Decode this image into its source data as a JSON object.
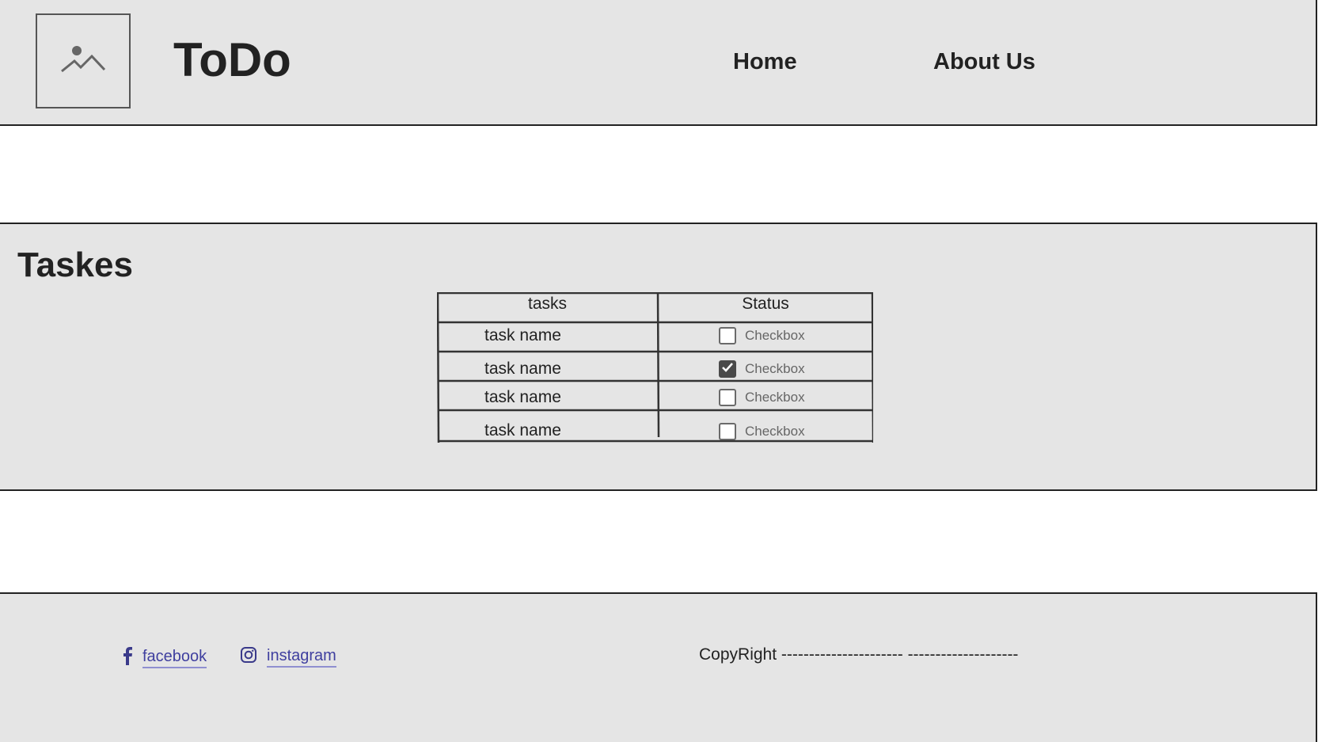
{
  "header": {
    "brand": "ToDo",
    "logo_icon": "image-placeholder-icon",
    "nav": [
      {
        "label": "Home"
      },
      {
        "label": "About Us"
      }
    ]
  },
  "tasks_section": {
    "title": "Taskes",
    "table": {
      "columns": [
        "tasks",
        "Status"
      ],
      "rows": [
        {
          "task": "task name",
          "status_label": "Checkbox",
          "checked": false
        },
        {
          "task": "task name",
          "status_label": "Checkbox",
          "checked": true
        },
        {
          "task": "task name",
          "status_label": "Checkbox",
          "checked": false
        },
        {
          "task": "task name",
          "status_label": "Checkbox",
          "checked": false
        }
      ]
    }
  },
  "footer": {
    "social": [
      {
        "label": "facebook",
        "icon": "facebook-icon"
      },
      {
        "label": "instagram",
        "icon": "instagram-icon"
      }
    ],
    "copyright": "CopyRight ---------------------- --------------------"
  },
  "colors": {
    "panel_bg": "#e5e5e5",
    "border": "#222222",
    "link": "#3f3f9f",
    "checkbox_checked": "#4a4a4a"
  }
}
